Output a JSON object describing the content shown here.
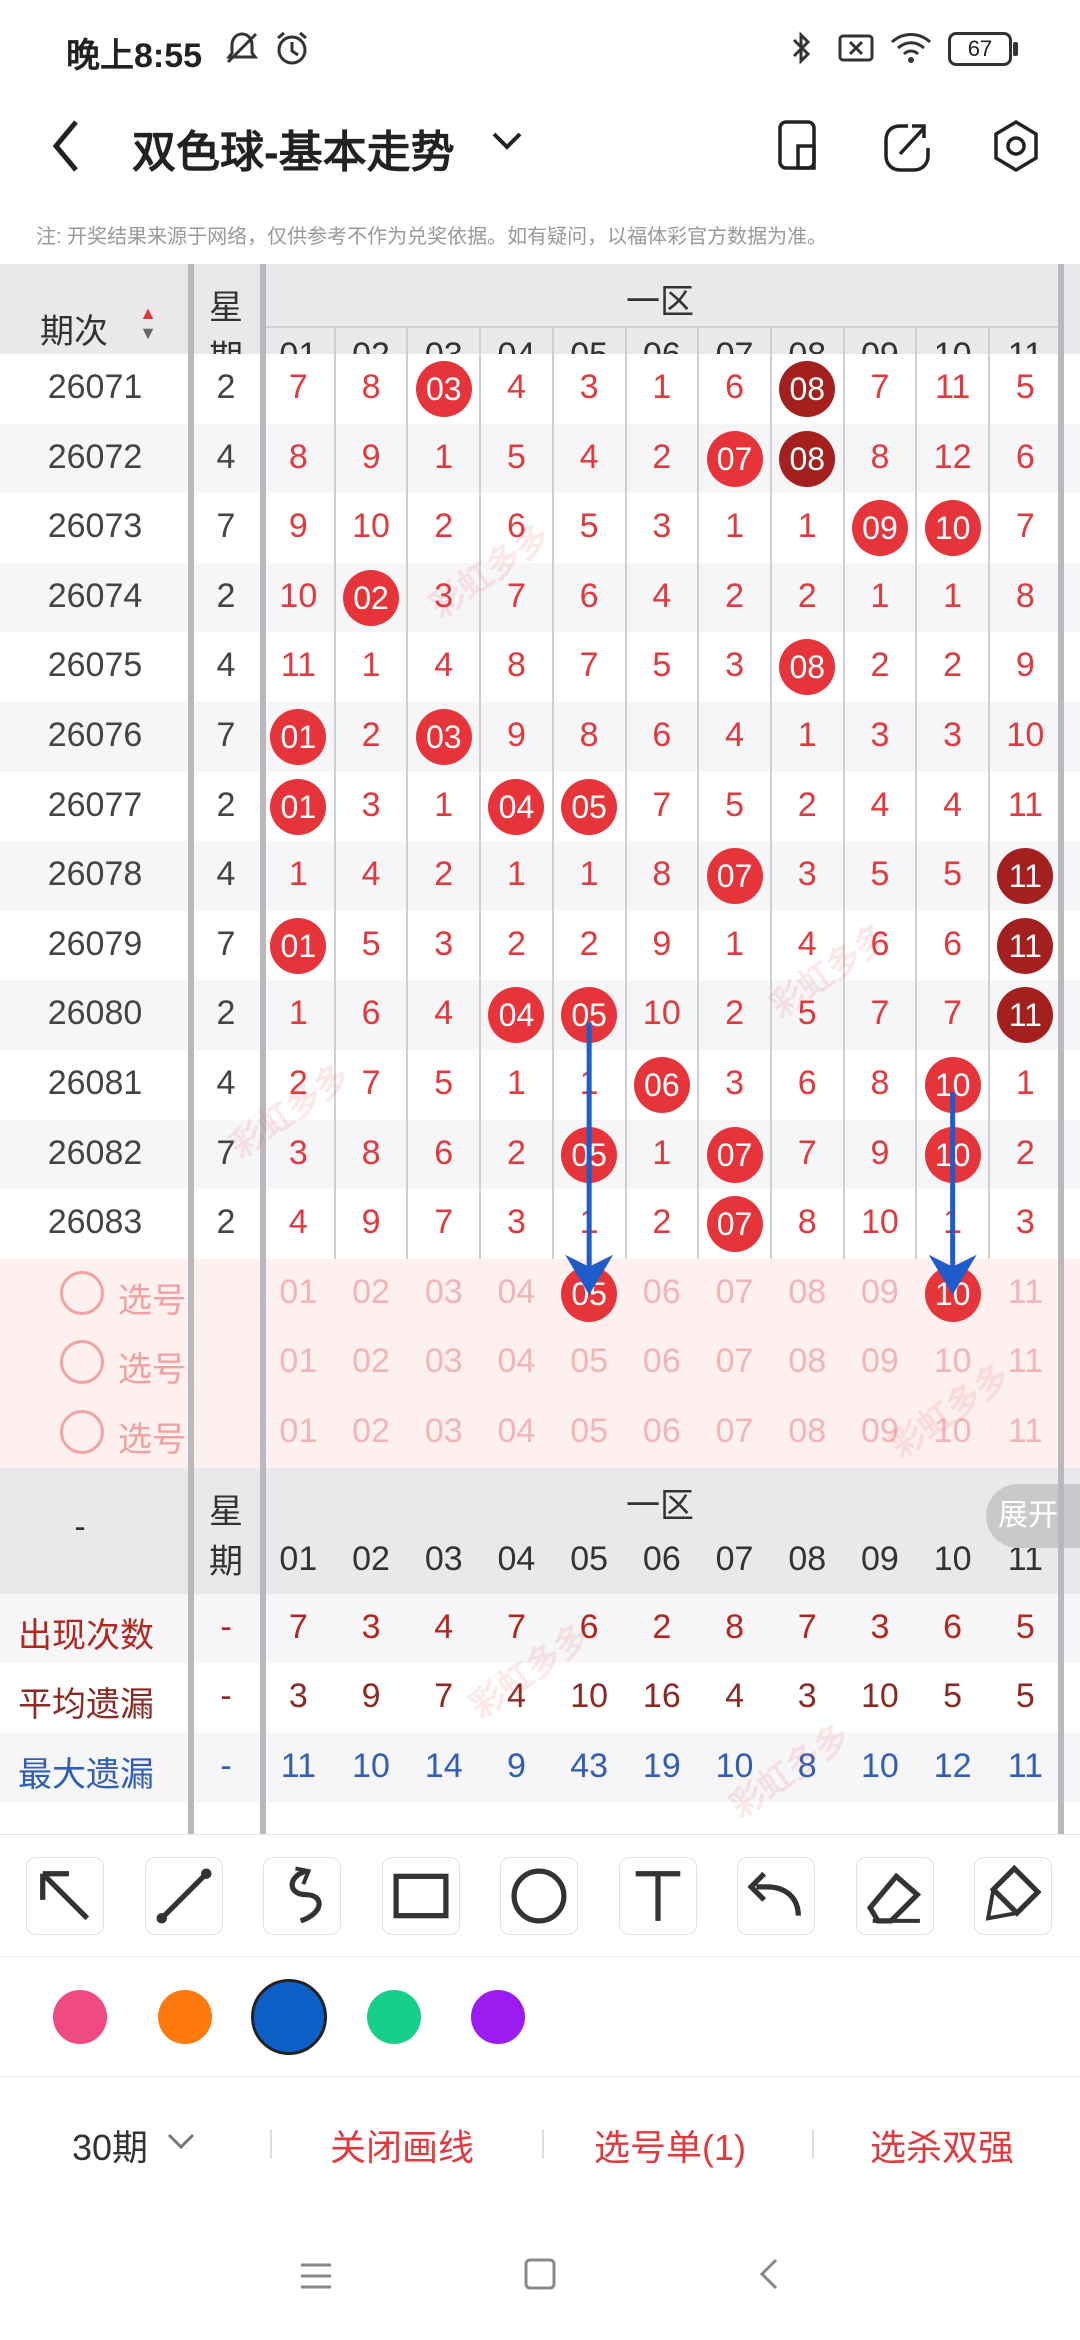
{
  "status_bar": {
    "time": "晚上8:55",
    "battery": "67"
  },
  "header": {
    "title": "双色球-基本走势",
    "note": "注: 开奖结果来源于网络，仅供参考不作为兑奖依据。如有疑问，以福体彩官方数据为准。"
  },
  "grid": {
    "period_header": "期次",
    "week_header_top": "星",
    "week_header_bottom": "期",
    "zone_label": "一区",
    "numbers": [
      "01",
      "02",
      "03",
      "04",
      "05",
      "06",
      "07",
      "08",
      "09",
      "10",
      "11"
    ],
    "rows": [
      {
        "period": "26071",
        "week": "2",
        "cells": [
          "7",
          "8",
          "03",
          "4",
          "3",
          "1",
          "6",
          "08",
          "7",
          "11",
          "5"
        ],
        "balls": {
          "2": "red",
          "7": "dark"
        }
      },
      {
        "period": "26072",
        "week": "4",
        "cells": [
          "8",
          "9",
          "1",
          "5",
          "4",
          "2",
          "07",
          "08",
          "8",
          "12",
          "6"
        ],
        "balls": {
          "6": "red",
          "7": "dark"
        }
      },
      {
        "period": "26073",
        "week": "7",
        "cells": [
          "9",
          "10",
          "2",
          "6",
          "5",
          "3",
          "1",
          "1",
          "09",
          "10",
          "7"
        ],
        "balls": {
          "8": "red",
          "9": "red"
        }
      },
      {
        "period": "26074",
        "week": "2",
        "cells": [
          "10",
          "02",
          "3",
          "7",
          "6",
          "4",
          "2",
          "2",
          "1",
          "1",
          "8"
        ],
        "balls": {
          "1": "red"
        }
      },
      {
        "period": "26075",
        "week": "4",
        "cells": [
          "11",
          "1",
          "4",
          "8",
          "7",
          "5",
          "3",
          "08",
          "2",
          "2",
          "9"
        ],
        "balls": {
          "7": "red"
        }
      },
      {
        "period": "26076",
        "week": "7",
        "cells": [
          "01",
          "2",
          "03",
          "9",
          "8",
          "6",
          "4",
          "1",
          "3",
          "3",
          "10"
        ],
        "balls": {
          "0": "red",
          "2": "red"
        }
      },
      {
        "period": "26077",
        "week": "2",
        "cells": [
          "01",
          "3",
          "1",
          "04",
          "05",
          "7",
          "5",
          "2",
          "4",
          "4",
          "11"
        ],
        "balls": {
          "0": "red",
          "3": "red",
          "4": "red"
        }
      },
      {
        "period": "26078",
        "week": "4",
        "cells": [
          "1",
          "4",
          "2",
          "1",
          "1",
          "8",
          "07",
          "3",
          "5",
          "5",
          "11"
        ],
        "balls": {
          "6": "red",
          "10": "dark"
        }
      },
      {
        "period": "26079",
        "week": "7",
        "cells": [
          "01",
          "5",
          "3",
          "2",
          "2",
          "9",
          "1",
          "4",
          "6",
          "6",
          "11"
        ],
        "balls": {
          "0": "red",
          "10": "dark"
        }
      },
      {
        "period": "26080",
        "week": "2",
        "cells": [
          "1",
          "6",
          "4",
          "04",
          "05",
          "10",
          "2",
          "5",
          "7",
          "7",
          "11"
        ],
        "balls": {
          "3": "red",
          "4": "red",
          "10": "dark"
        }
      },
      {
        "period": "26081",
        "week": "4",
        "cells": [
          "2",
          "7",
          "5",
          "1",
          "1",
          "06",
          "3",
          "6",
          "8",
          "10",
          "1"
        ],
        "balls": {
          "5": "red",
          "9": "red"
        }
      },
      {
        "period": "26082",
        "week": "7",
        "cells": [
          "3",
          "8",
          "6",
          "2",
          "05",
          "1",
          "07",
          "7",
          "9",
          "10",
          "2"
        ],
        "balls": {
          "4": "red",
          "6": "red",
          "9": "red"
        }
      },
      {
        "period": "26083",
        "week": "2",
        "cells": [
          "4",
          "9",
          "7",
          "3",
          "1",
          "2",
          "07",
          "8",
          "10",
          "1",
          "3"
        ],
        "balls": {
          "6": "red"
        }
      }
    ],
    "select_label": "选号",
    "select_rows": 3,
    "selected_marks": [
      {
        "row": 0,
        "col": 4,
        "text": "05"
      },
      {
        "row": 0,
        "col": 9,
        "text": "10"
      }
    ],
    "stats_header_dash": "-",
    "expand_button": "展开",
    "stats": [
      {
        "label": "出现次数",
        "dash": "-",
        "values": [
          "7",
          "3",
          "4",
          "7",
          "6",
          "2",
          "8",
          "7",
          "3",
          "6",
          "5"
        ],
        "color": "#b3261e"
      },
      {
        "label": "平均遗漏",
        "dash": "-",
        "values": [
          "3",
          "9",
          "7",
          "4",
          "10",
          "16",
          "4",
          "3",
          "10",
          "5",
          "5"
        ],
        "color": "#8b2a22"
      },
      {
        "label": "最大遗漏",
        "dash": "-",
        "values": [
          "11",
          "10",
          "14",
          "9",
          "43",
          "19",
          "10",
          "8",
          "10",
          "12",
          "11"
        ],
        "color": "#2f5db7"
      }
    ]
  },
  "toolbar": {
    "tools": [
      "arrow-tool",
      "line-tool",
      "curve-tool",
      "rect-tool",
      "circle-tool",
      "text-tool",
      "undo-tool",
      "eraser-tool",
      "clear-tool"
    ],
    "colors": [
      "#ef4b82",
      "#ff7a0e",
      "#0d5fc8",
      "#17cf8a",
      "#9b1bf0"
    ],
    "selected_color": "#0d5fc8"
  },
  "bottom_bar": {
    "period_select": "30期",
    "close_lines": "关闭画线",
    "selection_list": "选号单(1)",
    "kill_button": "选杀双强"
  },
  "annotations": {
    "arrow_color": "#1f5bc9"
  }
}
